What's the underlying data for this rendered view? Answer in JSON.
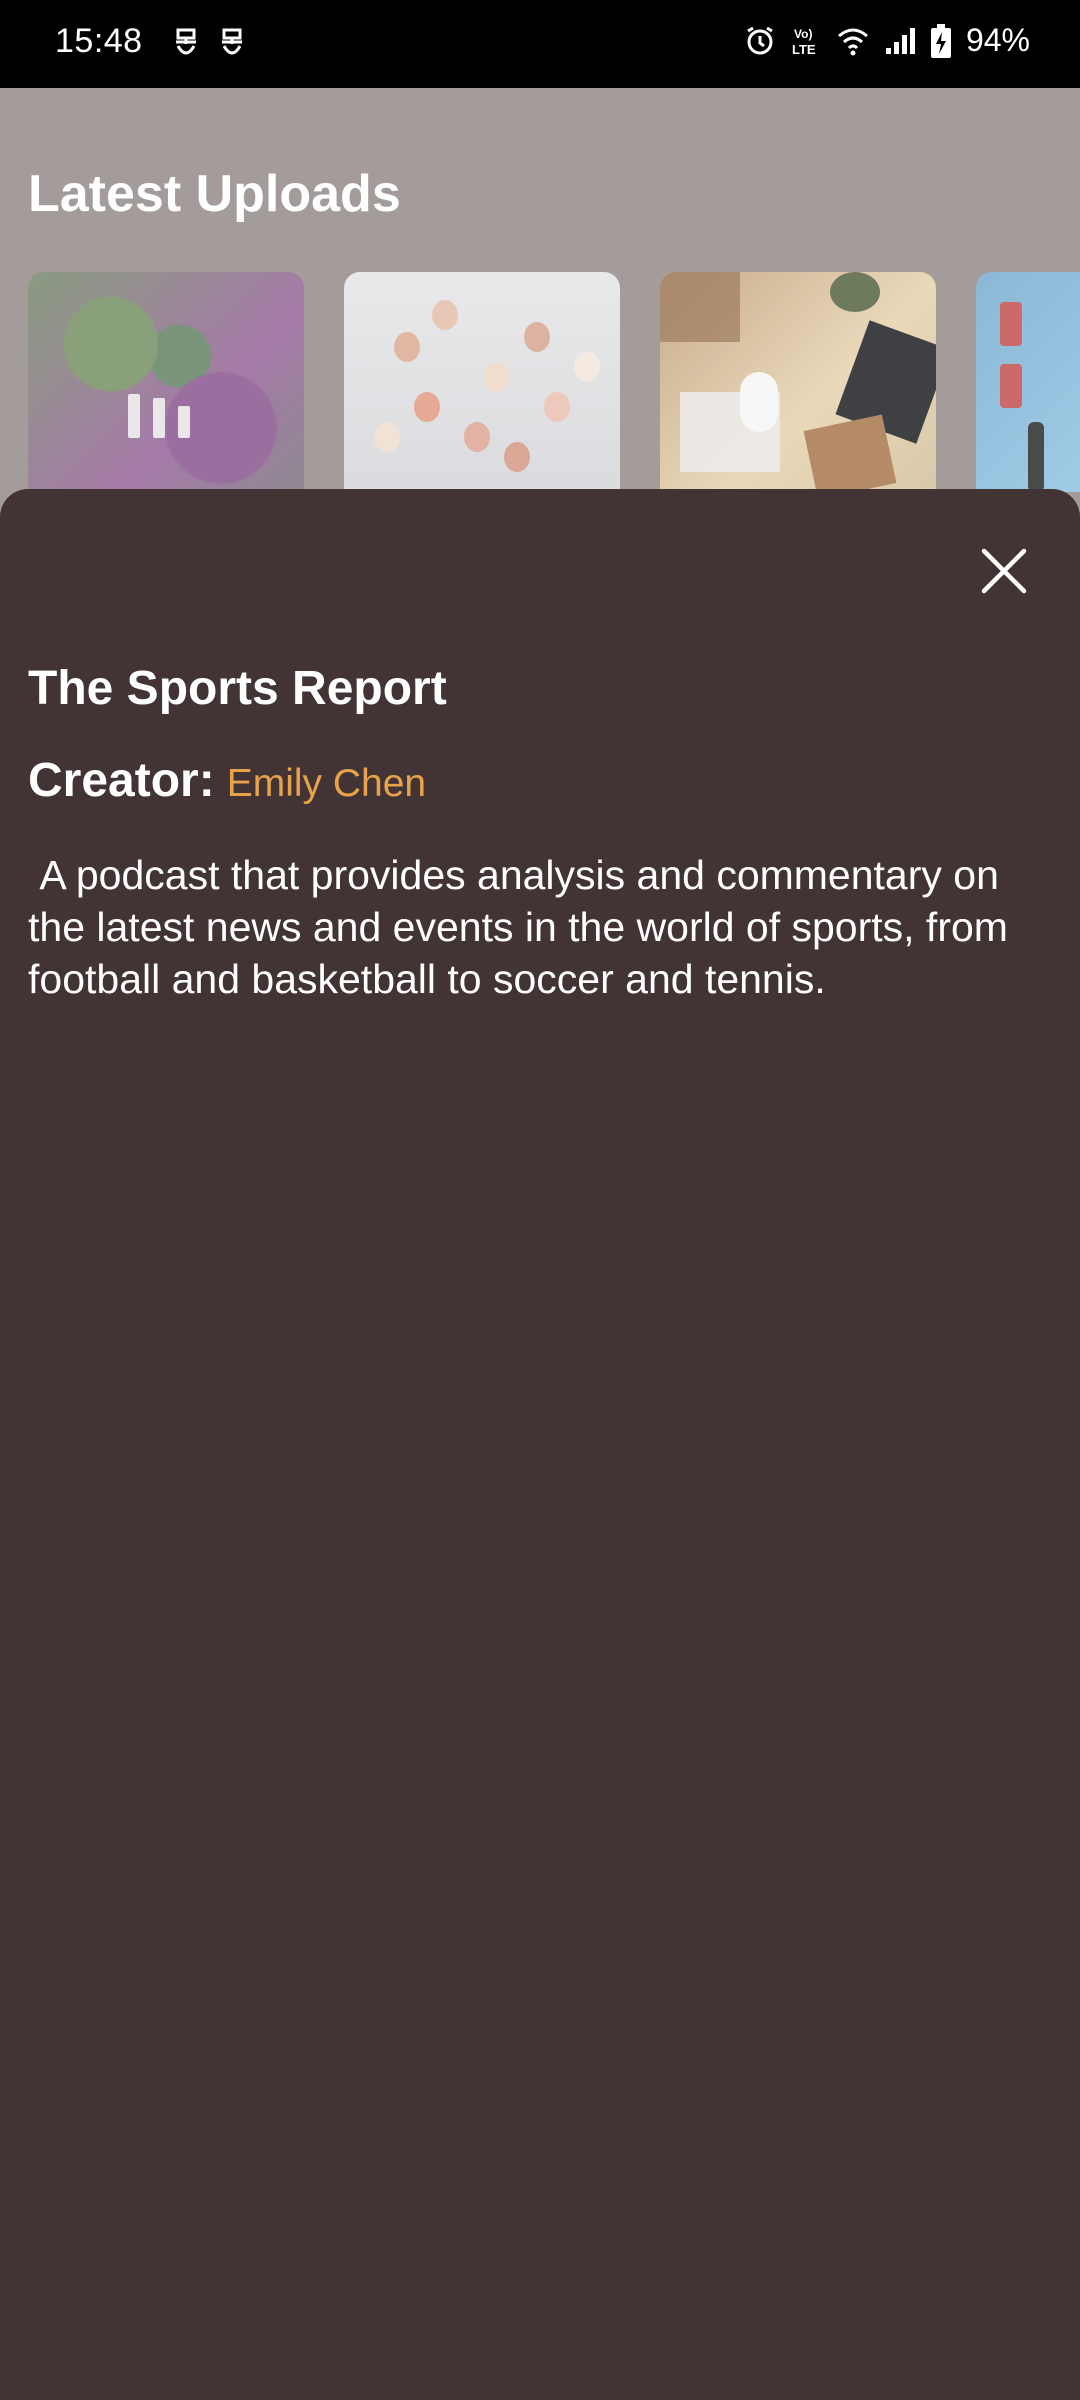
{
  "status_bar": {
    "time": "15:48",
    "battery": "94%",
    "network": "LTE",
    "icons": [
      "notification-icon",
      "notification-icon",
      "alarm-icon",
      "volte-lte-icon",
      "wifi-icon",
      "signal-icon",
      "battery-charging-icon"
    ]
  },
  "page": {
    "title": "Latest Uploads"
  },
  "sheet": {
    "title": "The Sports Report",
    "creator_label": "Creator:",
    "creator_name": "Emily Chen",
    "description": " A podcast that provides analysis and commentary on the latest news and events in the world of sports, from football and basketball to soccer and tennis.",
    "close_icon": "close-icon"
  },
  "colors": {
    "sheet_background": "#423334",
    "page_background": "#a39c9b",
    "accent": "#e8a24a"
  }
}
